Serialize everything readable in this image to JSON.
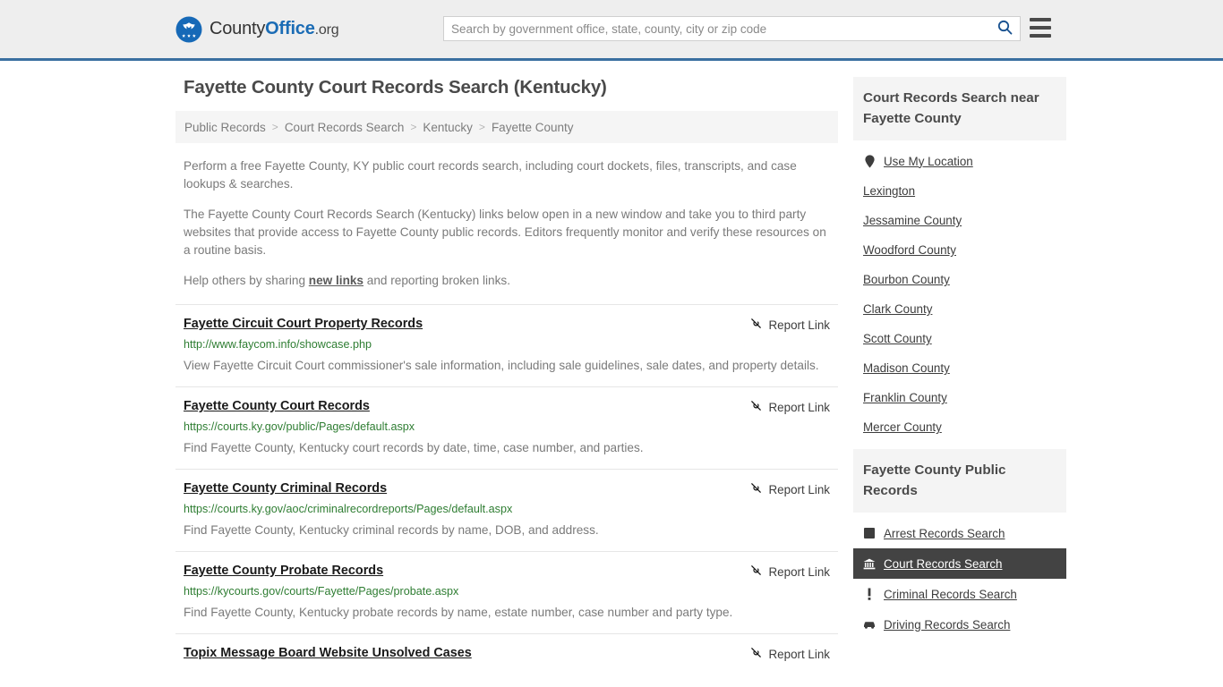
{
  "header": {
    "logo": {
      "icon": "eagle-shield-icon",
      "text_part1": "County",
      "text_part2": "Office",
      "text_part3": ".org",
      "brand_blue": "#1b6cb5"
    },
    "search": {
      "placeholder": "Search by government office, state, county, city or zip code",
      "value": "",
      "search_icon": "search-icon"
    },
    "menu_icon": "hamburger-menu-icon",
    "border_color": "#3a6fa0"
  },
  "page_title": "Fayette County Court Records Search (Kentucky)",
  "breadcrumb": {
    "separator": ">",
    "items": [
      {
        "label": "Public Records"
      },
      {
        "label": "Court Records Search"
      },
      {
        "label": "Kentucky"
      },
      {
        "label": "Fayette County"
      }
    ]
  },
  "intro": {
    "p1": "Perform a free Fayette County, KY public court records search, including court dockets, files, transcripts, and case lookups & searches.",
    "p2": "The Fayette County Court Records Search (Kentucky) links below open in a new window and take you to third party websites that provide access to Fayette County public records. Editors frequently monitor and verify these resources on a routine basis.",
    "p3_before": "Help others by sharing ",
    "p3_link": "new links",
    "p3_after": " and reporting broken links."
  },
  "report_link_label": "Report Link",
  "report_link_icon": "broken-link-icon",
  "results": [
    {
      "title": "Fayette Circuit Court Property Records",
      "url": "http://www.faycom.info/showcase.php",
      "description": "View Fayette Circuit Court commissioner's sale information, including sale guidelines, sale dates, and property details."
    },
    {
      "title": "Fayette County Court Records",
      "url": "https://courts.ky.gov/public/Pages/default.aspx",
      "description": "Find Fayette County, Kentucky court records by date, time, case number, and parties."
    },
    {
      "title": "Fayette County Criminal Records",
      "url": "https://courts.ky.gov/aoc/criminalrecordreports/Pages/default.aspx",
      "description": "Find Fayette County, Kentucky criminal records by name, DOB, and address."
    },
    {
      "title": "Fayette County Probate Records",
      "url": "https://kycourts.gov/courts/Fayette/Pages/probate.aspx",
      "description": "Find Fayette County, Kentucky probate records by name, estate number, case number and party type."
    },
    {
      "title": "Topix Message Board Website Unsolved Cases",
      "url": "",
      "description": ""
    }
  ],
  "sidebar": {
    "nearby": {
      "heading": "Court Records Search near Fayette County",
      "items": [
        {
          "label": "Use My Location",
          "icon": "map-pin-icon"
        },
        {
          "label": "Lexington",
          "icon": ""
        },
        {
          "label": "Jessamine County",
          "icon": ""
        },
        {
          "label": "Woodford County",
          "icon": ""
        },
        {
          "label": "Bourbon County",
          "icon": ""
        },
        {
          "label": "Clark County",
          "icon": ""
        },
        {
          "label": "Scott County",
          "icon": ""
        },
        {
          "label": "Madison County",
          "icon": ""
        },
        {
          "label": "Franklin County",
          "icon": ""
        },
        {
          "label": "Mercer County",
          "icon": ""
        }
      ]
    },
    "public_records": {
      "heading": "Fayette County Public Records",
      "active_index": 1,
      "items": [
        {
          "label": "Arrest Records Search",
          "icon": "fingerprint-square-icon"
        },
        {
          "label": "Court Records Search",
          "icon": "courthouse-icon"
        },
        {
          "label": "Criminal Records Search",
          "icon": "exclamation-icon"
        },
        {
          "label": "Driving Records Search",
          "icon": "car-icon"
        }
      ]
    },
    "active_bg": "#434343"
  }
}
